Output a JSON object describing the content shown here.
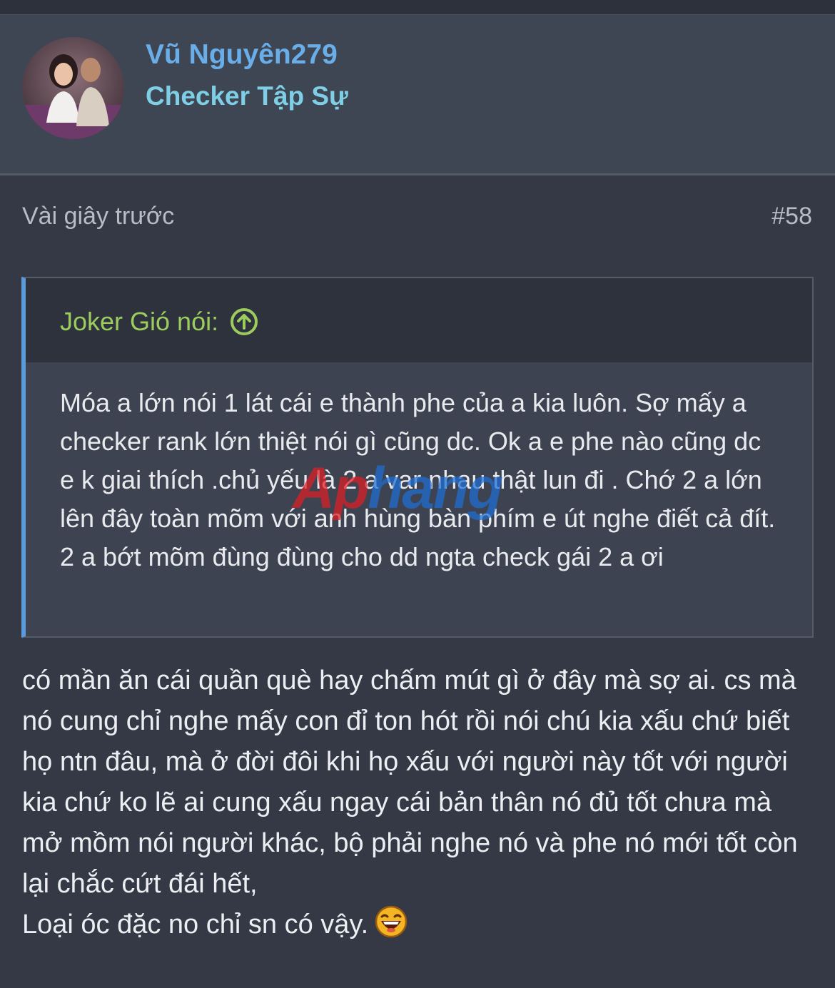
{
  "user": {
    "name": "Vũ Nguyên279",
    "title": "Checker Tập Sự"
  },
  "post": {
    "time": "Vài giây trước",
    "number": "#58"
  },
  "quote": {
    "author": "Joker Gió nói:",
    "text": "Móa a lớn nói 1 lát cái e thành phe của a kia luôn. Sợ mấy a checker rank lớn thiệt nói gì cũng dc. Ok a e phe nào cũng dc e k giai thích .chủ yếu là 2 a var nhau thật lun đi . Chớ 2 a lớn lên đây toàn mõm với anh hùng bàn phím e út nghe điết cả đít. 2 a bớt mõm đùng đùng cho dd ngta check gái 2 a ơi"
  },
  "reply": {
    "text": "có mần ăn cái quần què hay chấm mút gì ở đây mà sợ ai. cs mà nó cung chỉ nghe mấy con đỉ ton hót rồi nói chú kia xấu chứ biết họ ntn đâu, mà ở đời đôi khi họ xấu với người này tốt với người kia chứ ko lẽ ai cung xấu ngay cái bản thân nó đủ tốt chưa mà mở mồm nói người khác, bộ phải nghe nó và phe nó mới tốt còn lại chắc cứt đái hết,",
    "last_line": "Loại óc đặc no chỉ sn có vậy."
  },
  "watermark": {
    "part1": "Ap",
    "part2": "hang"
  },
  "icons": {
    "quote_arrow": "arrow-up-circle-icon",
    "emoji": "laughing-emoji-icon"
  },
  "colors": {
    "background": "#343945",
    "card": "#3f4653",
    "username": "#6aaee9",
    "usertitle": "#7ecfe6",
    "quote_author": "#9ccc5e",
    "quote_border": "#5b9bd9"
  }
}
